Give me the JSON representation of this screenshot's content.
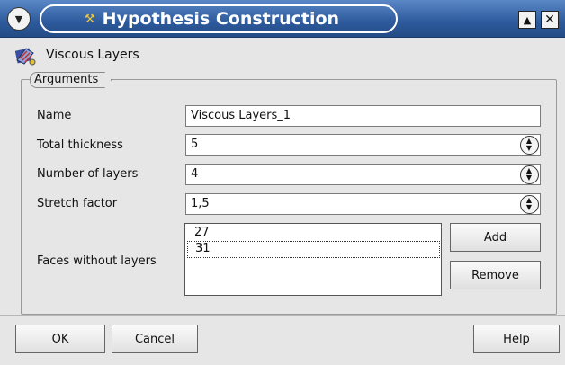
{
  "window": {
    "title": "Hypothesis Construction",
    "menu_icon": "chevron-down-icon",
    "maximize_icon": "maximize-icon",
    "close_icon": "close-icon"
  },
  "hypothesis": {
    "icon": "viscous-layers-icon",
    "name": "Viscous Layers"
  },
  "arguments": {
    "group_title": "Arguments",
    "fields": [
      {
        "label": "Name",
        "value": "Viscous Layers_1"
      },
      {
        "label": "Total thickness",
        "value": "5"
      },
      {
        "label": "Number of layers",
        "value": "4"
      },
      {
        "label": "Stretch factor",
        "value": "1,5"
      }
    ],
    "faces_label": "Faces without layers",
    "faces": [
      "27",
      "31"
    ],
    "add_button": "Add",
    "remove_button": "Remove"
  },
  "footer": {
    "ok_button": "OK",
    "cancel_button": "Cancel",
    "help_button": "Help"
  }
}
